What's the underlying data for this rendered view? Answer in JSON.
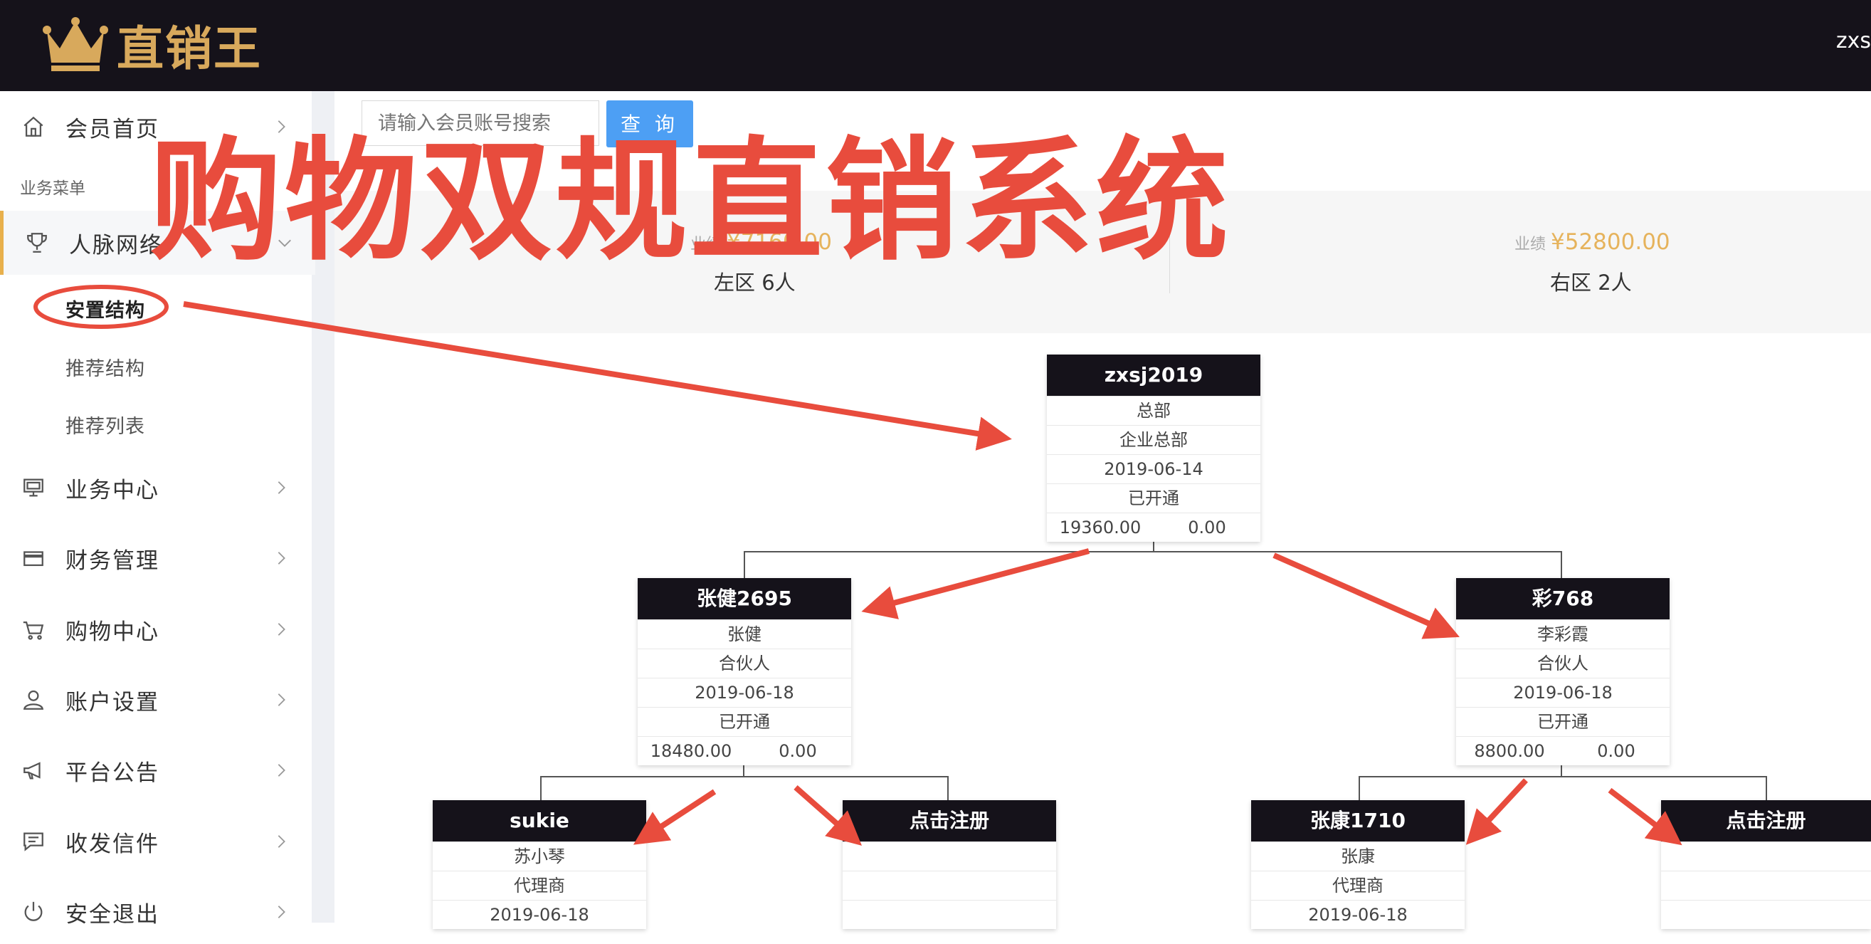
{
  "header": {
    "brand": "直销王",
    "user": "zxs"
  },
  "sidebar": {
    "home": "会员首页",
    "section": "业务菜单",
    "network": "人脉网络",
    "network_sub": [
      "安置结构",
      "推荐结构",
      "推荐列表"
    ],
    "items": [
      "业务中心",
      "财务管理",
      "购物中心",
      "账户设置",
      "平台公告",
      "收发信件",
      "安全退出"
    ]
  },
  "search": {
    "placeholder": "请输入会员账号搜索",
    "button": "查 询"
  },
  "stats": {
    "left_perf_label": "业绩",
    "left_perf_value": "¥7160.00",
    "left_count": "左区 6人",
    "right_perf_label": "业绩",
    "right_perf_value": "¥52800.00",
    "right_count": "右区 2人"
  },
  "tree": {
    "root": {
      "account": "zxsj2019",
      "name": "总部",
      "level": "企业总部",
      "date": "2019-06-14",
      "status": "已开通",
      "left": "19360.00",
      "right": "0.00"
    },
    "l": {
      "account": "张健2695",
      "name": "张健",
      "level": "合伙人",
      "date": "2019-06-18",
      "status": "已开通",
      "left": "18480.00",
      "right": "0.00"
    },
    "r": {
      "account": "彩768",
      "name": "李彩霞",
      "level": "合伙人",
      "date": "2019-06-18",
      "status": "已开通",
      "left": "8800.00",
      "right": "0.00"
    },
    "ll": {
      "account": "sukie",
      "name": "苏小琴",
      "level": "代理商",
      "date": "2019-06-18"
    },
    "lr": {
      "account": "点击注册"
    },
    "rl": {
      "account": "张康1710",
      "name": "张康",
      "level": "代理商",
      "date": "2019-06-18"
    },
    "rr": {
      "account": "点击注册"
    }
  },
  "overlay": {
    "title": "购物双规直销系统"
  },
  "colors": {
    "topbar": "#15121a",
    "brand_gold": "#d8a95c",
    "accent_red": "#e84c3d",
    "button_blue": "#4d9ff4",
    "perf_gold": "#e6b35c"
  }
}
